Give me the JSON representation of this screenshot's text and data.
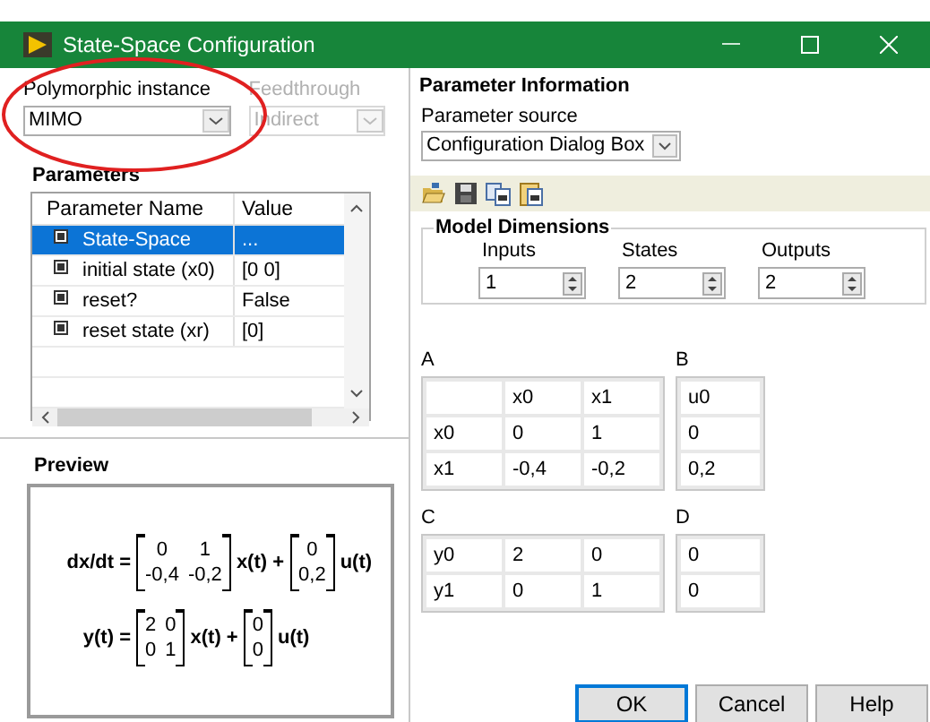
{
  "window": {
    "title": "State-Space Configuration"
  },
  "polymorphic": {
    "label": "Polymorphic instance",
    "value": "MIMO",
    "disabled": false
  },
  "feedthrough": {
    "label": "Feedthrough",
    "value": "Indirect",
    "disabled": true
  },
  "parameters": {
    "title": "Parameters",
    "columns": [
      "Parameter Name",
      "Value"
    ],
    "rows": [
      {
        "name": "State-Space",
        "value": "...",
        "selected": true
      },
      {
        "name": "initial state (x0)",
        "value": "[0 0]",
        "selected": false
      },
      {
        "name": "reset?",
        "value": "False",
        "selected": false
      },
      {
        "name": "reset state (xr)",
        "value": "[0]",
        "selected": false
      }
    ]
  },
  "preview": {
    "title": "Preview",
    "equations": [
      {
        "lhs": "dx/dt =",
        "terms": [
          {
            "kind": "matrix",
            "rows": [
              [
                "0",
                "1"
              ],
              [
                "-0,4",
                "-0,2"
              ]
            ]
          },
          {
            "kind": "text",
            "text": "x(t) +"
          },
          {
            "kind": "matrix",
            "rows": [
              [
                "0"
              ],
              [
                "0,2"
              ]
            ]
          },
          {
            "kind": "text",
            "text": "u(t)"
          }
        ]
      },
      {
        "lhs": "y(t) =",
        "terms": [
          {
            "kind": "matrix",
            "rows": [
              [
                "2",
                "0"
              ],
              [
                "0",
                "1"
              ]
            ]
          },
          {
            "kind": "text",
            "text": "x(t) +"
          },
          {
            "kind": "matrix",
            "rows": [
              [
                "0"
              ],
              [
                "0"
              ]
            ]
          },
          {
            "kind": "text",
            "text": "u(t)"
          }
        ]
      }
    ]
  },
  "parameter_information": {
    "title": "Parameter Information",
    "source_label": "Parameter source",
    "source_value": "Configuration Dialog Box"
  },
  "model_dimensions": {
    "title": "Model Dimensions",
    "fields": [
      {
        "label": "Inputs",
        "value": "1"
      },
      {
        "label": "States",
        "value": "2"
      },
      {
        "label": "Outputs",
        "value": "2"
      }
    ]
  },
  "matrices": [
    {
      "label": "A",
      "columns": [
        "x0",
        "x1"
      ],
      "rows": [
        {
          "header": "x0",
          "cells": [
            "0",
            "1"
          ]
        },
        {
          "header": "x1",
          "cells": [
            "-0,4",
            "-0,2"
          ]
        }
      ]
    },
    {
      "label": "B",
      "columns": [
        "u0"
      ],
      "rows": [
        {
          "cells": [
            "0"
          ]
        },
        {
          "cells": [
            "0,2"
          ]
        }
      ]
    },
    {
      "label": "C",
      "rows": [
        {
          "header": "y0",
          "cells": [
            "2",
            "0"
          ]
        },
        {
          "header": "y1",
          "cells": [
            "0",
            "1"
          ]
        }
      ]
    },
    {
      "label": "D",
      "rows": [
        {
          "cells": [
            "0"
          ]
        },
        {
          "cells": [
            "0"
          ]
        }
      ]
    }
  ],
  "buttons": [
    {
      "label": "OK",
      "default": true
    },
    {
      "label": "Cancel",
      "default": false
    },
    {
      "label": "Help",
      "default": false
    }
  ]
}
